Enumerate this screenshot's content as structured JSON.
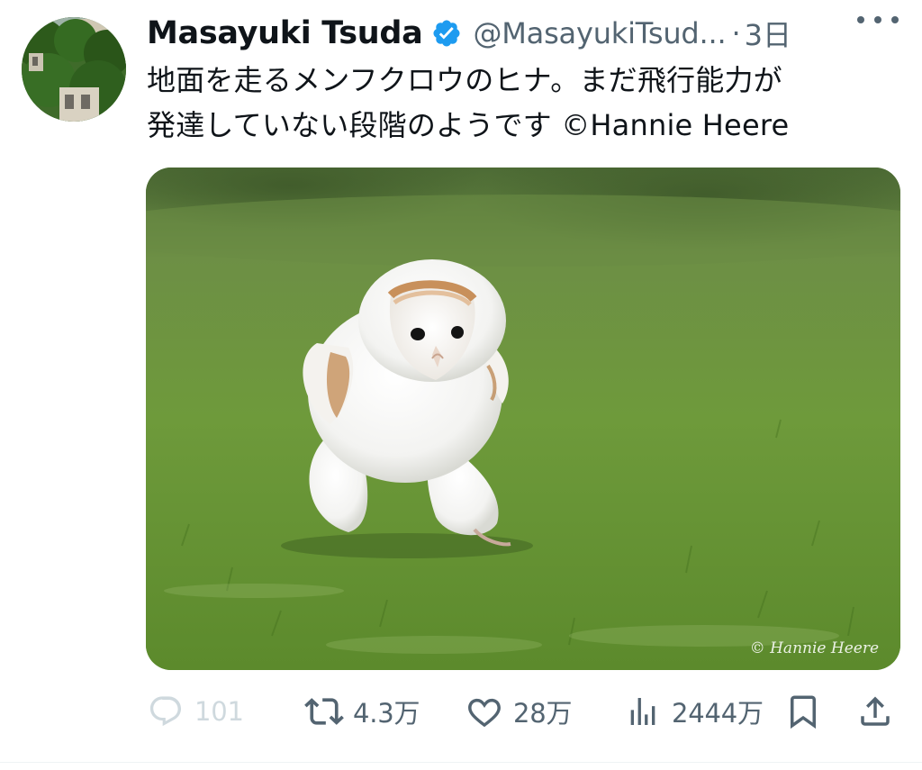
{
  "author": {
    "display_name": "Masayuki Tsuda",
    "handle": "@MasayukiTsud...",
    "verified": true,
    "time": "3日"
  },
  "tweet": {
    "text_lines": [
      "地面を走るメンフクロウのヒナ。まだ飛行能力が",
      "発達していない段階のようです ©Hannie Heere"
    ]
  },
  "media": {
    "subject": "Barn owl chick running on grass",
    "watermark": "© Hannie Heere"
  },
  "actions": {
    "reply_count": "101",
    "retweet_count": "4.3万",
    "like_count": "28万",
    "views_count": "2444万"
  },
  "colors": {
    "text_primary": "#0f1419",
    "text_secondary": "#536471",
    "verified_blue": "#1d9bf0",
    "reply_disabled": "#cfd9de"
  },
  "icons": {
    "verified": "verified-badge-icon",
    "more": "more-horizontal-icon",
    "reply": "reply-bubble-icon",
    "retweet": "retweet-icon",
    "like": "heart-icon",
    "views": "bar-chart-icon",
    "bookmark": "bookmark-icon",
    "share": "share-upload-icon"
  }
}
